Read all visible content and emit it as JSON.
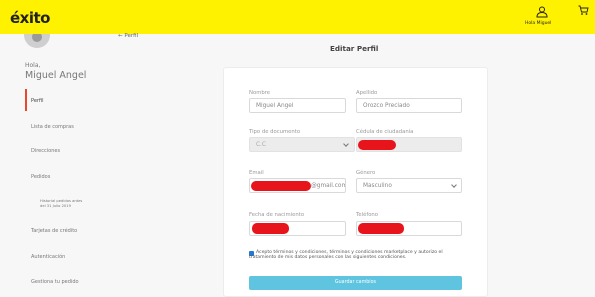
{
  "header": {
    "logo": "éxito",
    "user_label": "Hola Miguel",
    "bg_color": "#fff200"
  },
  "sidebar": {
    "greeting": "Hola,",
    "user_name": "Miguel Angel",
    "items": [
      {
        "label": "Perfil",
        "active": true
      },
      {
        "label": "Lista de compras"
      },
      {
        "label": "Direcciones"
      },
      {
        "label": "Pedidos"
      },
      {
        "label": "Historial pedidos antes del 31 Julio 2019"
      },
      {
        "label": "Tarjetas de crédito"
      },
      {
        "label": "Autenticación"
      },
      {
        "label": "Gestiona tu pedido"
      }
    ],
    "accent_color": "#e8472b"
  },
  "breadcrumb": {
    "back_label": "← Perfil"
  },
  "page_title": "Editar Perfil",
  "form": {
    "nombre_label": "Nombre",
    "nombre_value": "Miguel Angel",
    "apellido_label": "Apellido",
    "apellido_value": "Orozco Preciado",
    "tipo_doc_label": "Tipo de documento",
    "tipo_doc_value": "C.C",
    "cedula_label": "Cédula de ciudadanía",
    "email_label": "Email",
    "email_suffix": "@gmail.com",
    "genero_label": "Género",
    "genero_value": "Masculino",
    "fecha_label": "Fecha de nacimiento",
    "telefono_label": "Teléfono",
    "terms_text": "Acepto términos y condiciones, términos y condiciones marketplace y autorizo el tratamiento de mis datos personales con las siguientes condiciones.",
    "terms_checked": true,
    "save_label": "Guardar cambios",
    "save_color": "#5fc4e0"
  }
}
